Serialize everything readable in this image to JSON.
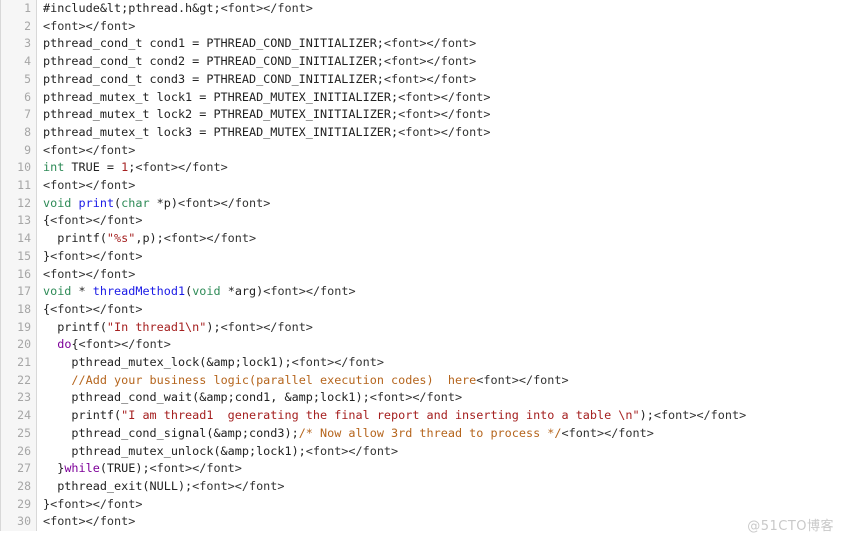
{
  "viewer": {
    "name": "code-snippet-viewer",
    "language": "c",
    "total_lines": 30,
    "colors": {
      "background": "#ffffff",
      "gutter_background": "#f6f6f6",
      "gutter_border": "#d8d8d8",
      "line_number": "#a6a6a6",
      "plain_text": "#222222",
      "keyword": "#2e8b57",
      "control_keyword": "#7d0099",
      "function_name": "#1a1ae6",
      "string": "#a52020",
      "number": "#a52020",
      "comment": "#b5651d"
    }
  },
  "watermark": {
    "text": "@51CTO博客"
  },
  "lines": [
    {
      "number": "1",
      "tokens": [
        {
          "t": "#include&lt;pthread.h&gt;",
          "c": "plain"
        },
        {
          "t": "<font></font>",
          "c": "tag"
        }
      ]
    },
    {
      "number": "2",
      "tokens": [
        {
          "t": "<font></font>",
          "c": "tag"
        }
      ]
    },
    {
      "number": "3",
      "tokens": [
        {
          "t": "pthread_cond_t cond1 = PTHREAD_COND_INITIALIZER;",
          "c": "plain"
        },
        {
          "t": "<font></font>",
          "c": "tag"
        }
      ]
    },
    {
      "number": "4",
      "tokens": [
        {
          "t": "pthread_cond_t cond2 = PTHREAD_COND_INITIALIZER;",
          "c": "plain"
        },
        {
          "t": "<font></font>",
          "c": "tag"
        }
      ]
    },
    {
      "number": "5",
      "tokens": [
        {
          "t": "pthread_cond_t cond3 = PTHREAD_COND_INITIALIZER;",
          "c": "plain"
        },
        {
          "t": "<font></font>",
          "c": "tag"
        }
      ]
    },
    {
      "number": "6",
      "tokens": [
        {
          "t": "pthread_mutex_t lock1 = PTHREAD_MUTEX_INITIALIZER;",
          "c": "plain"
        },
        {
          "t": "<font></font>",
          "c": "tag"
        }
      ]
    },
    {
      "number": "7",
      "tokens": [
        {
          "t": "pthread_mutex_t lock2 = PTHREAD_MUTEX_INITIALIZER;",
          "c": "plain"
        },
        {
          "t": "<font></font>",
          "c": "tag"
        }
      ]
    },
    {
      "number": "8",
      "tokens": [
        {
          "t": "pthread_mutex_t lock3 = PTHREAD_MUTEX_INITIALIZER;",
          "c": "plain"
        },
        {
          "t": "<font></font>",
          "c": "tag"
        }
      ]
    },
    {
      "number": "9",
      "tokens": [
        {
          "t": "<font></font>",
          "c": "tag"
        }
      ]
    },
    {
      "number": "10",
      "tokens": [
        {
          "t": "int",
          "c": "keyword"
        },
        {
          "t": " TRUE = ",
          "c": "plain"
        },
        {
          "t": "1",
          "c": "number"
        },
        {
          "t": ";",
          "c": "plain"
        },
        {
          "t": "<font></font>",
          "c": "tag"
        }
      ]
    },
    {
      "number": "11",
      "tokens": [
        {
          "t": "<font></font>",
          "c": "tag"
        }
      ]
    },
    {
      "number": "12",
      "tokens": [
        {
          "t": "void",
          "c": "keyword"
        },
        {
          "t": " ",
          "c": "plain"
        },
        {
          "t": "print",
          "c": "function"
        },
        {
          "t": "(",
          "c": "plain"
        },
        {
          "t": "char",
          "c": "keyword"
        },
        {
          "t": " *p)",
          "c": "plain"
        },
        {
          "t": "<font></font>",
          "c": "tag"
        }
      ]
    },
    {
      "number": "13",
      "tokens": [
        {
          "t": "{",
          "c": "plain"
        },
        {
          "t": "<font></font>",
          "c": "tag"
        }
      ]
    },
    {
      "number": "14",
      "tokens": [
        {
          "t": "  printf(",
          "c": "plain"
        },
        {
          "t": "\"%s\"",
          "c": "string"
        },
        {
          "t": ",p);",
          "c": "plain"
        },
        {
          "t": "<font></font>",
          "c": "tag"
        }
      ]
    },
    {
      "number": "15",
      "tokens": [
        {
          "t": "}",
          "c": "plain"
        },
        {
          "t": "<font></font>",
          "c": "tag"
        }
      ]
    },
    {
      "number": "16",
      "tokens": [
        {
          "t": "<font></font>",
          "c": "tag"
        }
      ]
    },
    {
      "number": "17",
      "tokens": [
        {
          "t": "void",
          "c": "keyword"
        },
        {
          "t": " * ",
          "c": "plain"
        },
        {
          "t": "threadMethod1",
          "c": "function"
        },
        {
          "t": "(",
          "c": "plain"
        },
        {
          "t": "void",
          "c": "keyword"
        },
        {
          "t": " *arg)",
          "c": "plain"
        },
        {
          "t": "<font></font>",
          "c": "tag"
        }
      ]
    },
    {
      "number": "18",
      "tokens": [
        {
          "t": "{",
          "c": "plain"
        },
        {
          "t": "<font></font>",
          "c": "tag"
        }
      ]
    },
    {
      "number": "19",
      "tokens": [
        {
          "t": "  printf(",
          "c": "plain"
        },
        {
          "t": "\"In thread1\\n\"",
          "c": "string"
        },
        {
          "t": ");",
          "c": "plain"
        },
        {
          "t": "<font></font>",
          "c": "tag"
        }
      ]
    },
    {
      "number": "20",
      "tokens": [
        {
          "t": "  ",
          "c": "plain"
        },
        {
          "t": "do",
          "c": "control"
        },
        {
          "t": "{",
          "c": "plain"
        },
        {
          "t": "<font></font>",
          "c": "tag"
        }
      ]
    },
    {
      "number": "21",
      "tokens": [
        {
          "t": "    pthread_mutex_lock(&amp;lock1);",
          "c": "plain"
        },
        {
          "t": "<font></font>",
          "c": "tag"
        }
      ]
    },
    {
      "number": "22",
      "tokens": [
        {
          "t": "    ",
          "c": "plain"
        },
        {
          "t": "//Add your business logic(parallel execution codes)  here",
          "c": "comment"
        },
        {
          "t": "<font></font>",
          "c": "tag"
        }
      ]
    },
    {
      "number": "23",
      "tokens": [
        {
          "t": "    pthread_cond_wait(&amp;cond1, &amp;lock1);",
          "c": "plain"
        },
        {
          "t": "<font></font>",
          "c": "tag"
        }
      ]
    },
    {
      "number": "24",
      "tokens": [
        {
          "t": "    printf(",
          "c": "plain"
        },
        {
          "t": "\"I am thread1  generating the final report and inserting into a table \\n\"",
          "c": "string"
        },
        {
          "t": ");",
          "c": "plain"
        },
        {
          "t": "<font></font>",
          "c": "tag"
        }
      ]
    },
    {
      "number": "25",
      "tokens": [
        {
          "t": "    pthread_cond_signal(&amp;cond3);",
          "c": "plain"
        },
        {
          "t": "/* Now allow 3rd thread to process */",
          "c": "comment"
        },
        {
          "t": "<font></font>",
          "c": "tag"
        }
      ]
    },
    {
      "number": "26",
      "tokens": [
        {
          "t": "    pthread_mutex_unlock(&amp;lock1);",
          "c": "plain"
        },
        {
          "t": "<font></font>",
          "c": "tag"
        }
      ]
    },
    {
      "number": "27",
      "tokens": [
        {
          "t": "  }",
          "c": "plain"
        },
        {
          "t": "while",
          "c": "control"
        },
        {
          "t": "(TRUE);",
          "c": "plain"
        },
        {
          "t": "<font></font>",
          "c": "tag"
        }
      ]
    },
    {
      "number": "28",
      "tokens": [
        {
          "t": "  pthread_exit(NULL);",
          "c": "plain"
        },
        {
          "t": "<font></font>",
          "c": "tag"
        }
      ]
    },
    {
      "number": "29",
      "tokens": [
        {
          "t": "}",
          "c": "plain"
        },
        {
          "t": "<font></font>",
          "c": "tag"
        }
      ]
    },
    {
      "number": "30",
      "tokens": [
        {
          "t": "<font></font>",
          "c": "tag"
        }
      ]
    }
  ]
}
